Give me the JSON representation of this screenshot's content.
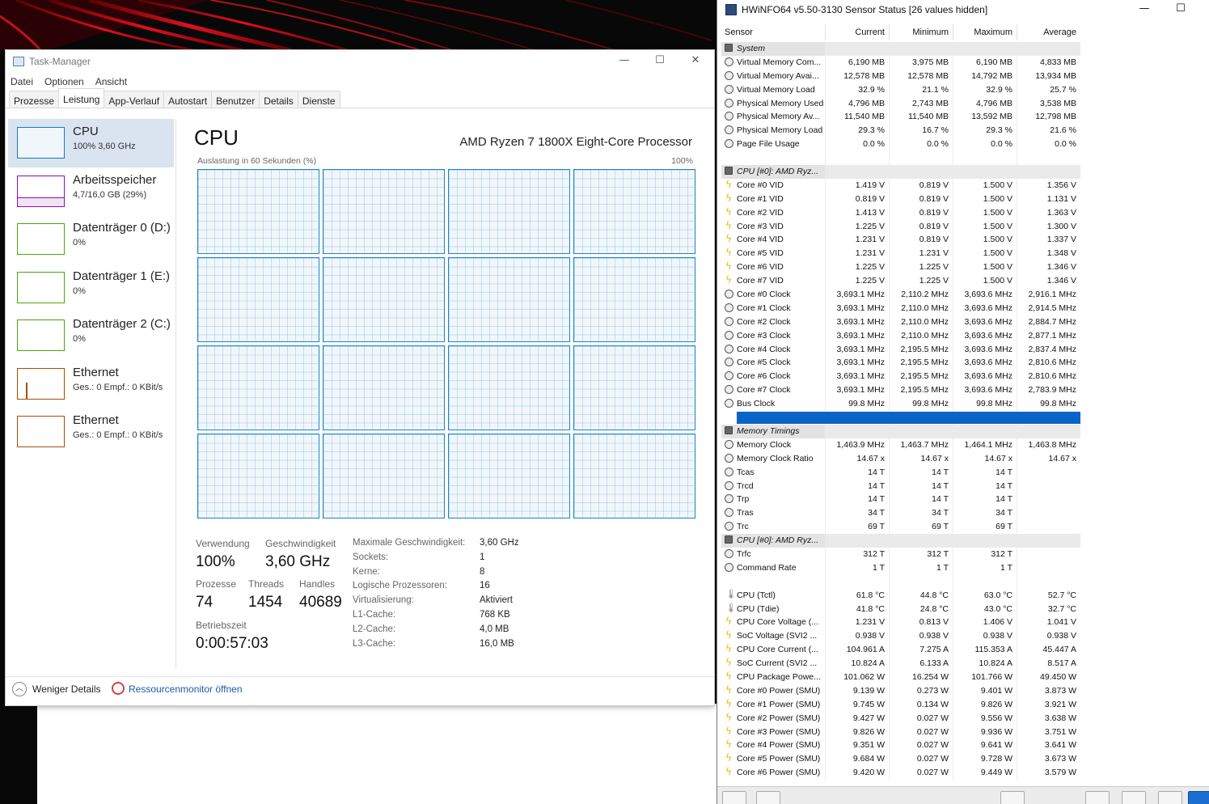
{
  "taskmgr": {
    "title": "Task-Manager",
    "controls": {
      "minimize": "—",
      "maximize": "☐",
      "close": "✕"
    },
    "menu": [
      "Datei",
      "Optionen",
      "Ansicht"
    ],
    "tabs": [
      "Prozesse",
      "Leistung",
      "App-Verlauf",
      "Autostart",
      "Benutzer",
      "Details",
      "Dienste"
    ],
    "sidebar": [
      {
        "name": "CPU",
        "sub": "100% 3,60 GHz",
        "color": "#117dbb"
      },
      {
        "name": "Arbeitsspeicher",
        "sub": "4,7/16,0 GB (29%)",
        "color": "#8b12ae"
      },
      {
        "name": "Datenträger 0 (D:)",
        "sub": "0%",
        "color": "#4da60c"
      },
      {
        "name": "Datenträger 1 (E:)",
        "sub": "0%",
        "color": "#4da60c"
      },
      {
        "name": "Datenträger 2 (C:)",
        "sub": "0%",
        "color": "#4da60c"
      },
      {
        "name": "Ethernet",
        "sub": "Ges.: 0 Empf.: 0 KBit/s",
        "color": "#a74f01"
      },
      {
        "name": "Ethernet",
        "sub": "Ges.: 0 Empf.: 0 KBit/s",
        "color": "#a74f01"
      }
    ],
    "main": {
      "title": "CPU",
      "model": "AMD Ryzen 7 1800X Eight-Core Processor",
      "graph_label": "Auslastung in 60 Sekunden (%)",
      "graph_max": "100%",
      "stats": {
        "util_label": "Verwendung",
        "util": "100%",
        "speed_label": "Geschwindigkeit",
        "speed": "3,60 GHz",
        "proc_label": "Prozesse",
        "proc": "74",
        "threads_label": "Threads",
        "threads": "1454",
        "handles_label": "Handles",
        "handles": "40689",
        "uptime_label": "Betriebszeit",
        "uptime": "0:00:57:03"
      },
      "details": [
        {
          "k": "Maximale Geschwindigkeit:",
          "v": "3,60 GHz"
        },
        {
          "k": "Sockets:",
          "v": "1"
        },
        {
          "k": "Kerne:",
          "v": "8"
        },
        {
          "k": "Logische Prozessoren:",
          "v": "16"
        },
        {
          "k": "Virtualisierung:",
          "v": "Aktiviert"
        },
        {
          "k": "L1-Cache:",
          "v": "768 KB"
        },
        {
          "k": "L2-Cache:",
          "v": "4,0 MB"
        },
        {
          "k": "L3-Cache:",
          "v": "16,0 MB"
        }
      ]
    },
    "footer": {
      "less": "Weniger Details",
      "resmon": "Ressourcenmonitor öffnen"
    }
  },
  "hwinfo": {
    "title": "HWiNFO64 v5.50-3130 Sensor Status [26 values hidden]",
    "controls": {
      "minimize": "—",
      "maximize": "☐"
    },
    "headers": [
      "Sensor",
      "Current",
      "Minimum",
      "Maximum",
      "Average"
    ],
    "rows": [
      {
        "t": "g",
        "n": "System"
      },
      {
        "t": "c",
        "n": "Virtual Memory Com...",
        "v": [
          "6,190 MB",
          "3,975 MB",
          "6,190 MB",
          "4,833 MB"
        ]
      },
      {
        "t": "c",
        "n": "Virtual Memory Avai...",
        "v": [
          "12,578 MB",
          "12,578 MB",
          "14,792 MB",
          "13,934 MB"
        ]
      },
      {
        "t": "c",
        "n": "Virtual Memory Load",
        "v": [
          "32.9 %",
          "21.1 %",
          "32.9 %",
          "25.7 %"
        ]
      },
      {
        "t": "c",
        "n": "Physical Memory Used",
        "v": [
          "4,796 MB",
          "2,743 MB",
          "4,796 MB",
          "3,538 MB"
        ]
      },
      {
        "t": "c",
        "n": "Physical Memory Av...",
        "v": [
          "11,540 MB",
          "11,540 MB",
          "13,592 MB",
          "12,798 MB"
        ]
      },
      {
        "t": "c",
        "n": "Physical Memory Load",
        "v": [
          "29.3 %",
          "16.7 %",
          "29.3 %",
          "21.6 %"
        ]
      },
      {
        "t": "c",
        "n": "Page File Usage",
        "v": [
          "0.0 %",
          "0.0 %",
          "0.0 %",
          "0.0 %"
        ]
      },
      {
        "t": "e"
      },
      {
        "t": "g",
        "n": "CPU [#0]: AMD Ryz..."
      },
      {
        "t": "b",
        "n": "Core #0 VID",
        "v": [
          "1.419 V",
          "0.819 V",
          "1.500 V",
          "1.356 V"
        ]
      },
      {
        "t": "b",
        "n": "Core #1 VID",
        "v": [
          "0.819 V",
          "0.819 V",
          "1.500 V",
          "1.131 V"
        ]
      },
      {
        "t": "b",
        "n": "Core #2 VID",
        "v": [
          "1.413 V",
          "0.819 V",
          "1.500 V",
          "1.363 V"
        ]
      },
      {
        "t": "b",
        "n": "Core #3 VID",
        "v": [
          "1.225 V",
          "0.819 V",
          "1.500 V",
          "1.300 V"
        ]
      },
      {
        "t": "b",
        "n": "Core #4 VID",
        "v": [
          "1.231 V",
          "0.819 V",
          "1.500 V",
          "1.337 V"
        ]
      },
      {
        "t": "b",
        "n": "Core #5 VID",
        "v": [
          "1.231 V",
          "1.231 V",
          "1.500 V",
          "1.348 V"
        ]
      },
      {
        "t": "b",
        "n": "Core #6 VID",
        "v": [
          "1.225 V",
          "1.225 V",
          "1.500 V",
          "1.346 V"
        ]
      },
      {
        "t": "b",
        "n": "Core #7 VID",
        "v": [
          "1.225 V",
          "1.225 V",
          "1.500 V",
          "1.346 V"
        ]
      },
      {
        "t": "c",
        "n": "Core #0 Clock",
        "v": [
          "3,693.1 MHz",
          "2,110.2 MHz",
          "3,693.6 MHz",
          "2,916.1 MHz"
        ]
      },
      {
        "t": "c",
        "n": "Core #1 Clock",
        "v": [
          "3,693.1 MHz",
          "2,110.0 MHz",
          "3,693.6 MHz",
          "2,914.5 MHz"
        ]
      },
      {
        "t": "c",
        "n": "Core #2 Clock",
        "v": [
          "3,693.1 MHz",
          "2,110.0 MHz",
          "3,693.6 MHz",
          "2,884.7 MHz"
        ]
      },
      {
        "t": "c",
        "n": "Core #3 Clock",
        "v": [
          "3,693.1 MHz",
          "2,110.0 MHz",
          "3,693.6 MHz",
          "2,877.1 MHz"
        ]
      },
      {
        "t": "c",
        "n": "Core #4 Clock",
        "v": [
          "3,693.1 MHz",
          "2,195.5 MHz",
          "3,693.6 MHz",
          "2,837.4 MHz"
        ]
      },
      {
        "t": "c",
        "n": "Core #5 Clock",
        "v": [
          "3,693.1 MHz",
          "2,195.5 MHz",
          "3,693.6 MHz",
          "2,810.6 MHz"
        ]
      },
      {
        "t": "c",
        "n": "Core #6 Clock",
        "v": [
          "3,693.1 MHz",
          "2,195.5 MHz",
          "3,693.6 MHz",
          "2,810.6 MHz"
        ]
      },
      {
        "t": "c",
        "n": "Core #7 Clock",
        "v": [
          "3,693.1 MHz",
          "2,195.5 MHz",
          "3,693.6 MHz",
          "2,783.9 MHz"
        ]
      },
      {
        "t": "c",
        "n": "Bus Clock",
        "v": [
          "99.8 MHz",
          "99.8 MHz",
          "99.8 MHz",
          "99.8 MHz"
        ]
      },
      {
        "t": "s"
      },
      {
        "t": "g",
        "n": "Memory Timings"
      },
      {
        "t": "c",
        "n": "Memory Clock",
        "v": [
          "1,463.9 MHz",
          "1,463.7 MHz",
          "1,464.1 MHz",
          "1,463.8 MHz"
        ]
      },
      {
        "t": "c",
        "n": "Memory Clock Ratio",
        "v": [
          "14.67 x",
          "14.67 x",
          "14.67 x",
          "14.67 x"
        ]
      },
      {
        "t": "c",
        "n": "Tcas",
        "v": [
          "14 T",
          "14 T",
          "14 T",
          ""
        ]
      },
      {
        "t": "c",
        "n": "Trcd",
        "v": [
          "14 T",
          "14 T",
          "14 T",
          ""
        ]
      },
      {
        "t": "c",
        "n": "Trp",
        "v": [
          "14 T",
          "14 T",
          "14 T",
          ""
        ]
      },
      {
        "t": "c",
        "n": "Tras",
        "v": [
          "34 T",
          "34 T",
          "34 T",
          ""
        ]
      },
      {
        "t": "c",
        "n": "Trc",
        "v": [
          "69 T",
          "69 T",
          "69 T",
          ""
        ]
      },
      {
        "t": "g",
        "n": "CPU [#0]: AMD Ryz..."
      },
      {
        "t": "c",
        "n": "Trfc",
        "v": [
          "312 T",
          "312 T",
          "312 T",
          ""
        ]
      },
      {
        "t": "c",
        "n": "Command Rate",
        "v": [
          "1 T",
          "1 T",
          "1 T",
          ""
        ]
      },
      {
        "t": "e"
      },
      {
        "t": "th",
        "n": "CPU (Tctl)",
        "v": [
          "61.8 °C",
          "44.8 °C",
          "63.0 °C",
          "52.7 °C"
        ]
      },
      {
        "t": "th",
        "n": "CPU (Tdie)",
        "v": [
          "41.8 °C",
          "24.8 °C",
          "43.0 °C",
          "32.7 °C"
        ]
      },
      {
        "t": "b",
        "n": "CPU Core Voltage (...",
        "v": [
          "1.231 V",
          "0.813 V",
          "1.406 V",
          "1.041 V"
        ]
      },
      {
        "t": "b",
        "n": "SoC Voltage (SVI2 ...",
        "v": [
          "0.938 V",
          "0.938 V",
          "0.938 V",
          "0.938 V"
        ]
      },
      {
        "t": "b",
        "n": "CPU Core Current (...",
        "v": [
          "104.961 A",
          "7.275 A",
          "115.353 A",
          "45.447 A"
        ]
      },
      {
        "t": "b",
        "n": "SoC Current (SVI2 ...",
        "v": [
          "10.824 A",
          "6.133 A",
          "10.824 A",
          "8.517 A"
        ]
      },
      {
        "t": "b",
        "n": "CPU Package Powe...",
        "v": [
          "101.062 W",
          "16.254 W",
          "101.766 W",
          "49.450 W"
        ]
      },
      {
        "t": "b",
        "n": "Core #0 Power (SMU)",
        "v": [
          "9.139 W",
          "0.273 W",
          "9.401 W",
          "3.873 W"
        ]
      },
      {
        "t": "b",
        "n": "Core #1 Power (SMU)",
        "v": [
          "9.745 W",
          "0.134 W",
          "9.826 W",
          "3.921 W"
        ]
      },
      {
        "t": "b",
        "n": "Core #2 Power (SMU)",
        "v": [
          "9.427 W",
          "0.027 W",
          "9.556 W",
          "3.638 W"
        ]
      },
      {
        "t": "b",
        "n": "Core #3 Power (SMU)",
        "v": [
          "9.826 W",
          "0.027 W",
          "9.936 W",
          "3.751 W"
        ]
      },
      {
        "t": "b",
        "n": "Core #4 Power (SMU)",
        "v": [
          "9.351 W",
          "0.027 W",
          "9.641 W",
          "3.641 W"
        ]
      },
      {
        "t": "b",
        "n": "Core #5 Power (SMU)",
        "v": [
          "9.684 W",
          "0.027 W",
          "9.728 W",
          "3.673 W"
        ]
      },
      {
        "t": "b",
        "n": "Core #6 Power (SMU)",
        "v": [
          "9.420 W",
          "0.027 W",
          "9.449 W",
          "3.579 W"
        ]
      }
    ]
  }
}
